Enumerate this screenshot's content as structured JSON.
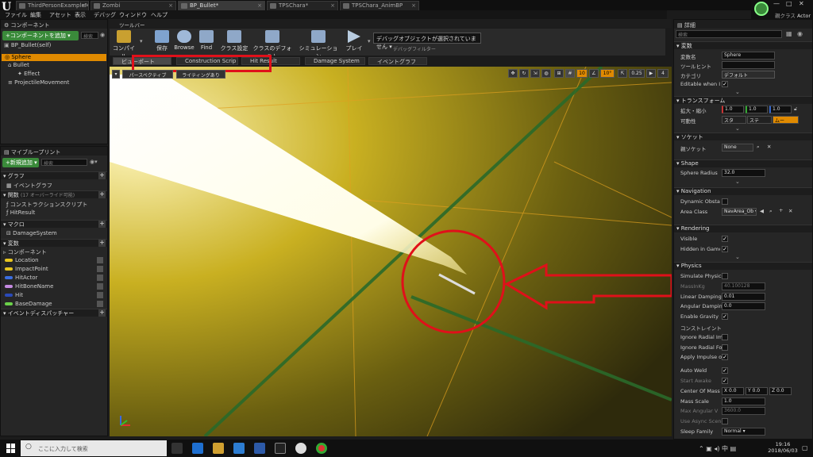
{
  "window": {
    "tabs": [
      "ThirdPersonExampleMap*",
      "Zombi",
      "BP_Bullet*",
      "TPSChara*",
      "TPSChara_AnimBP"
    ],
    "parent_class_label": "親クラス",
    "parent_class_value": "Actor"
  },
  "menu": [
    "ファイル",
    "編集",
    "アセット",
    "表示",
    "デバッグ",
    "ウィンドウ",
    "ヘルプ"
  ],
  "components_panel": {
    "title": "コンポーネント",
    "add_button": "+コンポーネントを追加 ▾",
    "search_placeholder": "検索",
    "items": [
      "BP_Bullet(self)",
      "Sphere",
      "Bullet",
      "Effect",
      "ProjectileMovement"
    ]
  },
  "blueprint_panel": {
    "title": "マイブループリント",
    "add_button": "+新規追加 ▾",
    "search_placeholder": "検索",
    "sections": {
      "graph": "グラフ",
      "event_graph": "イベントグラフ",
      "functions": "関数",
      "functions_note": "(17 オーバーライド可能)",
      "construction": "コンストラクションスクリプト",
      "hitresult": "HitResult",
      "macros": "マクロ",
      "damage_system": "DamageSystem",
      "variables": "変数",
      "components_sub": "コンポーネント",
      "dispatchers": "イベントディスパッチャー"
    },
    "variables": [
      "Location",
      "ImpactPoint",
      "HitActor",
      "HitBoneName",
      "Hit",
      "BaseDamage"
    ],
    "variable_colors": [
      "#e8c620",
      "#e8c620",
      "#3b6ee0",
      "#c48ae0",
      "#2a4ab8",
      "#6bd14a"
    ]
  },
  "toolbar": {
    "title": "ツールバー",
    "buttons": [
      "コンパイル",
      "保存",
      "Browse",
      "Find",
      "クラス設定",
      "クラスのデフォルト",
      "シミュレーション",
      "プレイ"
    ],
    "debug_dropdown": "デバッグオブジェクトが選択されていません ▾",
    "debug_filter": "デバッグフィルター"
  },
  "editor_tabs": [
    "ビューポート",
    "Construction Scrip",
    "Hit Result",
    "Damage System",
    "イベントグラフ"
  ],
  "viewport": {
    "mode_button": "パースペクティブ",
    "lit_button": "ライティングあり",
    "grid_snap": "10",
    "rot_snap": "10°",
    "scale_snap": "0.25",
    "camera_speed": "4"
  },
  "details": {
    "title": "詳細",
    "search_placeholder": "検索",
    "sections": {
      "variable": "変数",
      "transform": "トランスフォーム",
      "sockets": "ソケット",
      "shape": "Shape",
      "navigation": "Navigation",
      "rendering": "Rendering",
      "physics": "Physics"
    },
    "var_name_label": "変数名",
    "var_name_value": "Sphere",
    "tooltip_label": "ツールヒント",
    "category_label": "カテゴリ",
    "category_value": "デフォルト",
    "editable_label": "Editable when Inhe",
    "scale_label": "拡大・縮小",
    "scale_values": [
      "1.0",
      "1.0",
      "1.0"
    ],
    "mobility_label": "可動性",
    "mobility_options": [
      "スタ",
      "ステ",
      "ムー"
    ],
    "parent_socket_label": "親ソケット",
    "parent_socket_value": "None",
    "sphere_radius_label": "Sphere Radius",
    "sphere_radius_value": "32.0",
    "dynamic_obstacle_label": "Dynamic Obstacle",
    "area_class_label": "Area Class",
    "area_class_value": "NavArea_Ob ▾",
    "visible_label": "Visible",
    "hidden_label": "Hidden in Game",
    "physics_rows": [
      {
        "label": "Simulate Physics",
        "value": ""
      },
      {
        "label": "MassInKg",
        "value": "40.100128"
      },
      {
        "label": "Linear Damping",
        "value": "0.01"
      },
      {
        "label": "Angular Damping",
        "value": "0.0"
      },
      {
        "label": "Enable Gravity",
        "value": ""
      },
      {
        "label": "コンストレイント",
        "value": ""
      },
      {
        "label": "Ignore Radial Impu",
        "value": ""
      },
      {
        "label": "Ignore Radial Forc",
        "value": ""
      },
      {
        "label": "Apply Impulse on D",
        "value": ""
      },
      {
        "label": "Auto Weld",
        "value": ""
      },
      {
        "label": "Start Awake",
        "value": ""
      },
      {
        "label": "Center Of Mass O",
        "value": ""
      },
      {
        "label": "Mass Scale",
        "value": "1.0"
      },
      {
        "label": "Max Angular V",
        "value": "3600.0"
      },
      {
        "label": "Use Async Scene",
        "value": ""
      },
      {
        "label": "Sleep Family",
        "value": "Normal ▾"
      }
    ],
    "com_values": [
      "X 0.0",
      "Y 0.0",
      "Z 0.0"
    ]
  },
  "taskbar": {
    "search_placeholder": "ここに入力して検索",
    "time": "19:16",
    "date": "2018/06/03"
  },
  "colors": {
    "selection": "#e08a00",
    "annotation": "#e0101a",
    "add_button": "#3a8a3a"
  }
}
